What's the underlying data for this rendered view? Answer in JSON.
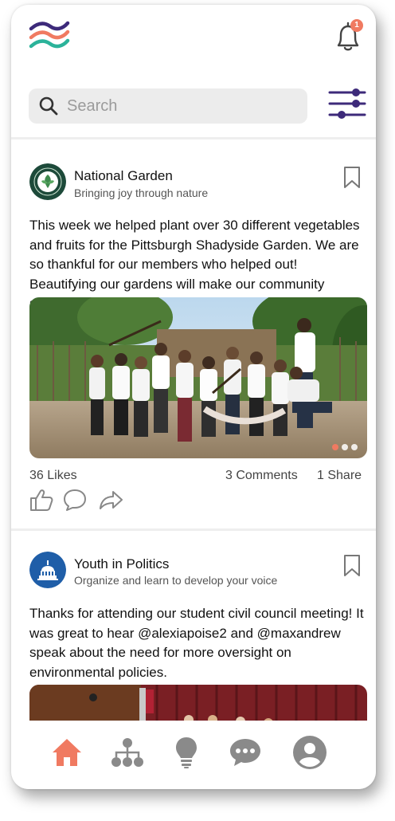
{
  "header": {
    "logo_icon": "wave-logo-icon",
    "notification_icon": "bell-icon",
    "notification_count": "1",
    "filter_icon": "sliders-icon"
  },
  "search": {
    "placeholder": "Search",
    "icon": "search-icon"
  },
  "colors": {
    "accent": "#f07a61",
    "brand_purple": "#3d2a7a",
    "brand_teal": "#2bb39a",
    "icon_gray": "#8a8a8a"
  },
  "posts": [
    {
      "org_name": "National Garden",
      "tagline": "Bringing joy through nature",
      "text": "This week we helped plant over 30 different vegetables and fruits for the Pittsburgh Shadyside Garden. We are so thankful for our members who helped out! Beautifying our gardens will make our community stronger.",
      "likes": "36 Likes",
      "comments": "3 Comments",
      "shares": "1 Share",
      "carousel_count": 3,
      "carousel_active_index": 0
    },
    {
      "org_name": "Youth in Politics",
      "tagline": "Organize and learn to develop your voice",
      "text": "Thanks for attending our student civil council meeting! It was great to hear @alexiapoise2 and @maxandrew speak about the need for more oversight on environmental policies."
    }
  ],
  "nav": {
    "items": [
      {
        "icon": "home-icon",
        "active": true
      },
      {
        "icon": "network-icon",
        "active": false
      },
      {
        "icon": "lightbulb-icon",
        "active": false
      },
      {
        "icon": "chat-icon",
        "active": false
      },
      {
        "icon": "profile-icon",
        "active": false
      }
    ]
  }
}
